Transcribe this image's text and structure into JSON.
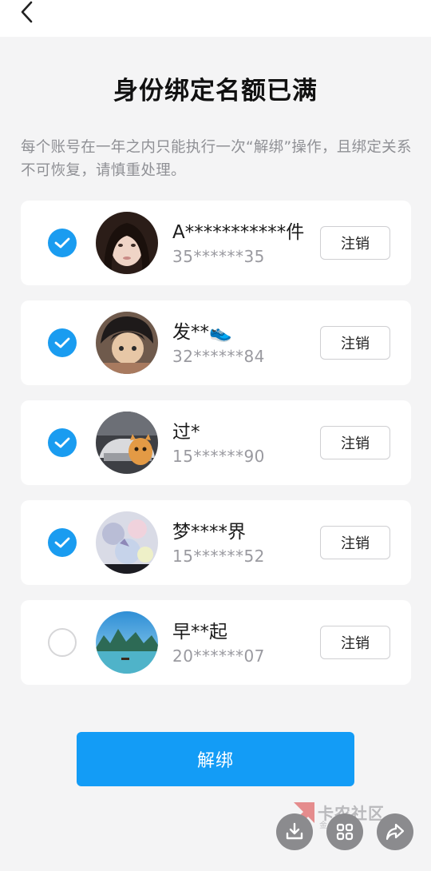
{
  "header": {
    "back_icon": "chevron-left-icon"
  },
  "title": "身份绑定名额已满",
  "description": "每个账号在一年之内只能执行一次“解绑”操作，且绑定关系不可恢复，请慎重处理。",
  "accounts": [
    {
      "name": "A***********件",
      "account": "35******35",
      "checked": true,
      "cancel_label": "注销"
    },
    {
      "name": "发**👟",
      "account": "32******84",
      "checked": true,
      "cancel_label": "注销"
    },
    {
      "name": "过*",
      "account": "15******90",
      "checked": true,
      "cancel_label": "注销"
    },
    {
      "name": "梦****界",
      "account": "15******52",
      "checked": true,
      "cancel_label": "注销"
    },
    {
      "name": "早**起",
      "account": "20******07",
      "checked": false,
      "cancel_label": "注销"
    }
  ],
  "unbind_label": "解绑",
  "watermark": {
    "text": "卡农社区",
    "subtext": "金融教育"
  },
  "colors": {
    "accent": "#139cf6",
    "check": "#1a9cf0",
    "background": "#f4f4f5"
  }
}
